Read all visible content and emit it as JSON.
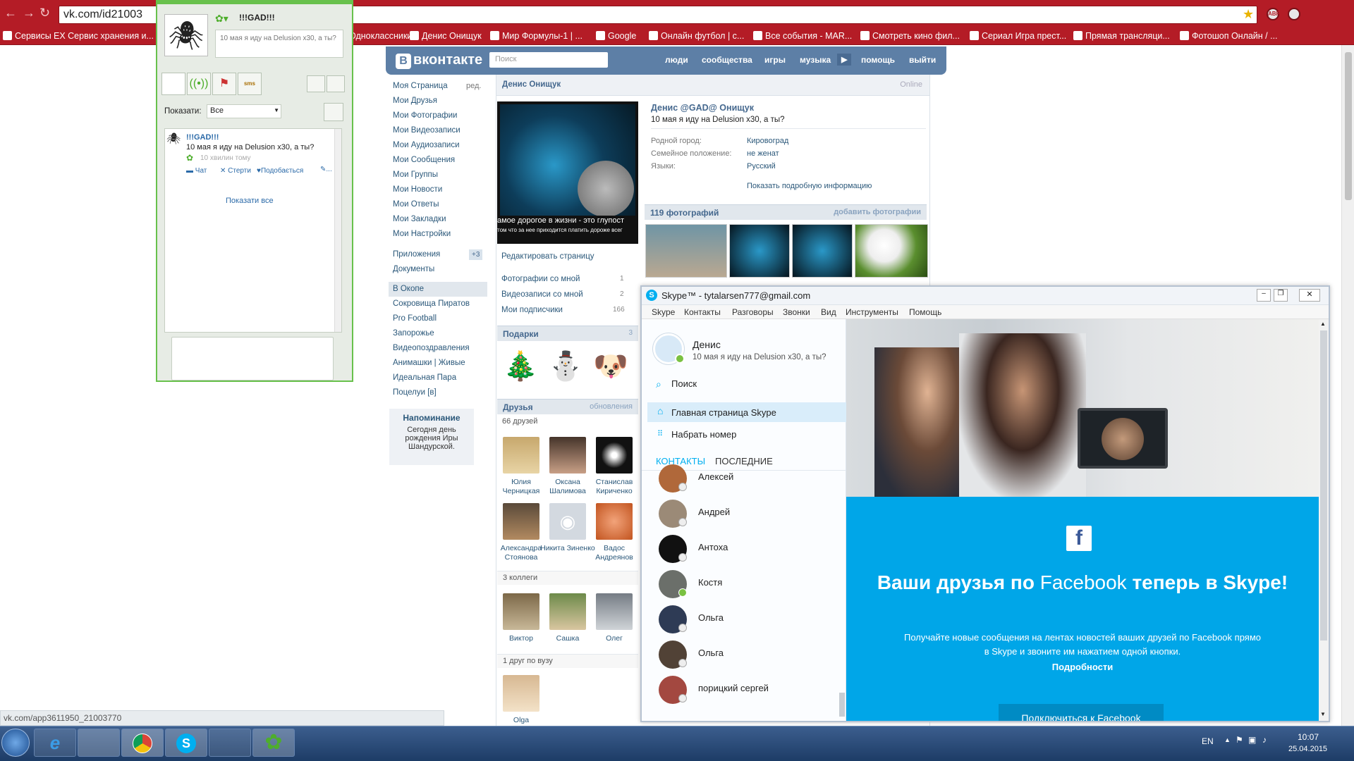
{
  "browser": {
    "url": "vk.com/id21003",
    "bookmarks": [
      "Сервисы",
      "EX Сервис хранения и...",
      "Одноклассники",
      "Денис Онищук",
      "Мир Формулы-1 | ...",
      "Google",
      "Онлайн футбол | с...",
      "Все события - MAR...",
      "Смотреть кино фил...",
      "Сериал Игра прест...",
      "Прямая трансляци...",
      "Фотошоп Онлайн / ..."
    ],
    "status_url": "vk.com/app3611950_21003770"
  },
  "vk": {
    "logo": "вконтакте",
    "search_placeholder": "Поиск",
    "nav": [
      "люди",
      "сообщества",
      "игры",
      "музыка",
      "помощь",
      "выйти"
    ],
    "menu": [
      "Моя Страница",
      "Мои Друзья",
      "Мои Фотографии",
      "Мои Видеозаписи",
      "Мои Аудиозаписи",
      "Мои Сообщения",
      "Мои Группы",
      "Мои Новости",
      "Мои Ответы",
      "Мои Закладки",
      "Мои Настройки"
    ],
    "menu_edit": "ред.",
    "apps": [
      "Приложения",
      "Документы"
    ],
    "apps_badge": "+3",
    "groups": [
      "В Окопе",
      "Сокровища Пиратов",
      "Pro Football",
      "Запорожье",
      "Видеопоздравления",
      "Анимашки | Живые",
      "Идеальная Пара",
      "Поцелуи [в]"
    ],
    "reminder_title": "Напоминание",
    "reminder_text": "Сегодня день рождения Иры Шандурской.",
    "page_title": "Денис Онищук",
    "online": "Online",
    "profile_name": "Денис @GAD@ Онищук",
    "status": "10 мая я иду на Delusion x30, а ты?",
    "avatar_caption1": "амое дорогое в жизни - это глупост",
    "avatar_caption2": "том что за нее приходится платить дороже всег",
    "info": [
      {
        "label": "Родной город:",
        "value": "Кировоград"
      },
      {
        "label": "Семейное положение:",
        "value": "не женат"
      },
      {
        "label": "Языки:",
        "value": "Русский"
      }
    ],
    "show_more": "Показать подробную информацию",
    "photos_header": "119 фотографий",
    "add_photos": "добавить фотографии",
    "edit_page": "Редактировать страницу",
    "counters": [
      {
        "label": "Фотографии со мной",
        "count": "1"
      },
      {
        "label": "Видеозаписи со мной",
        "count": "2"
      },
      {
        "label": "Мои подписчики",
        "count": "166"
      }
    ],
    "gifts_header": "Подарки",
    "gifts_count": "3",
    "friends_header": "Друзья",
    "friends_updates": "обновления",
    "friends_count": "66 друзей",
    "friends": [
      {
        "name": "Юлия Черницкая"
      },
      {
        "name": "Оксана Шалимова"
      },
      {
        "name": "Станислав Кириченко"
      },
      {
        "name": "Александра Стоянова"
      },
      {
        "name": "Никита Зиненко"
      },
      {
        "name": "Вадос Андреянов"
      }
    ],
    "colleagues_count": "3 коллеги",
    "colleagues": [
      {
        "name": "Виктор"
      },
      {
        "name": "Сашка"
      },
      {
        "name": "Олег"
      }
    ],
    "uni_count": "1 друг по вузу",
    "uni_friend": "Olga"
  },
  "icq": {
    "nick": "!!!GAD!!!",
    "status_text": "10 мая я иду на Delusion x30, а ты?",
    "show_label": "Показати:",
    "show_value": "Все",
    "feed_name": "!!!GAD!!!",
    "feed_text": "10 мая я иду на Delusion x30, а ты?",
    "feed_time": "10 хвилин тому",
    "actions": [
      "Чат",
      "Стерти",
      "Подобається",
      "..."
    ],
    "show_all": "Показати все"
  },
  "skype": {
    "title": "Skype™ - tytalarsen777@gmail.com",
    "menu": [
      "Skype",
      "Контакты",
      "Разговоры",
      "Звонки",
      "Вид",
      "Инструменты",
      "Помощь"
    ],
    "user_name": "Денис",
    "user_status": "10 мая я иду на Delusion x30, а ты?",
    "search": "Поиск",
    "home": "Главная страница Skype",
    "dial": "Набрать номер",
    "tab_contacts": "КОНТАКТЫ",
    "tab_recent": "ПОСЛЕДНИЕ",
    "contacts": [
      "Алексей",
      "Андрей",
      "Антоха",
      "Костя",
      "Ольга",
      "Ольга",
      "порицкий сергей"
    ],
    "fb_title_pre": "Ваши друзья по",
    "fb_title_fb": "Facebook",
    "fb_title_post": "теперь в Skype!",
    "fb_text": "Получайте новые сообщения на лентах новостей ваших друзей по Facebook прямо в Skype и звоните им нажатием одной кнопки.",
    "fb_more": "Подробности",
    "fb_button": "Подключиться к Facebook"
  },
  "taskbar": {
    "lang": "EN",
    "time": "10:07",
    "date": "25.04.2015"
  },
  "colors": {
    "browser_red": "#b41c26",
    "vk_blue": "#5d7fa6",
    "skype_blue": "#00a6e8",
    "icq_green": "#68c14c"
  }
}
